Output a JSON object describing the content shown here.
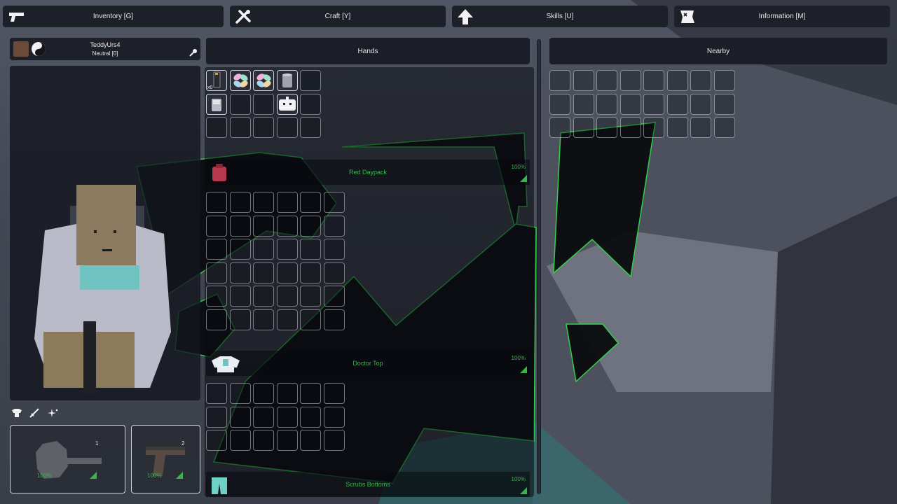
{
  "tabs": [
    {
      "label": "Inventory [G]",
      "icon": "pistol-icon"
    },
    {
      "label": "Craft [Y]",
      "icon": "tools-icon"
    },
    {
      "label": "Skills [U]",
      "icon": "arrow-up-icon"
    },
    {
      "label": "Information [M]",
      "icon": "map-icon"
    }
  ],
  "player": {
    "name": "TeddyUrs4",
    "reputation": "Neutral [0]"
  },
  "sections": {
    "hands": "Hands",
    "nearby": "Nearby"
  },
  "hands_items": [
    {
      "icon": "magazine-icon",
      "qty": "x0"
    },
    {
      "icon": "pills-icon"
    },
    {
      "icon": "pills-icon"
    },
    {
      "icon": "canned-food-icon"
    },
    {
      "icon": "bandage-icon"
    },
    {
      "icon": "walkie-talkie-icon"
    }
  ],
  "containers": [
    {
      "name": "Red Daypack",
      "condition": "100%",
      "icon": "backpack-icon",
      "color": "#b5394a"
    },
    {
      "name": "Doctor Top",
      "condition": "100%",
      "icon": "shirt-icon",
      "color": "#e9eef2"
    },
    {
      "name": "Scrubs Bottoms",
      "condition": "100%",
      "icon": "pants-icon",
      "color": "#6fd0c6"
    }
  ],
  "tool_icons": [
    "clothing-icon",
    "weapon-icon",
    "skills-sparkle-icon"
  ],
  "hotbar": [
    {
      "slot": "1",
      "condition": "100%",
      "icon": "frying-pan-icon"
    },
    {
      "slot": "2",
      "condition": "100%",
      "icon": "pistol-icon"
    }
  ],
  "colors": {
    "accent_green": "#39b54a",
    "panel": "#1e2029"
  }
}
